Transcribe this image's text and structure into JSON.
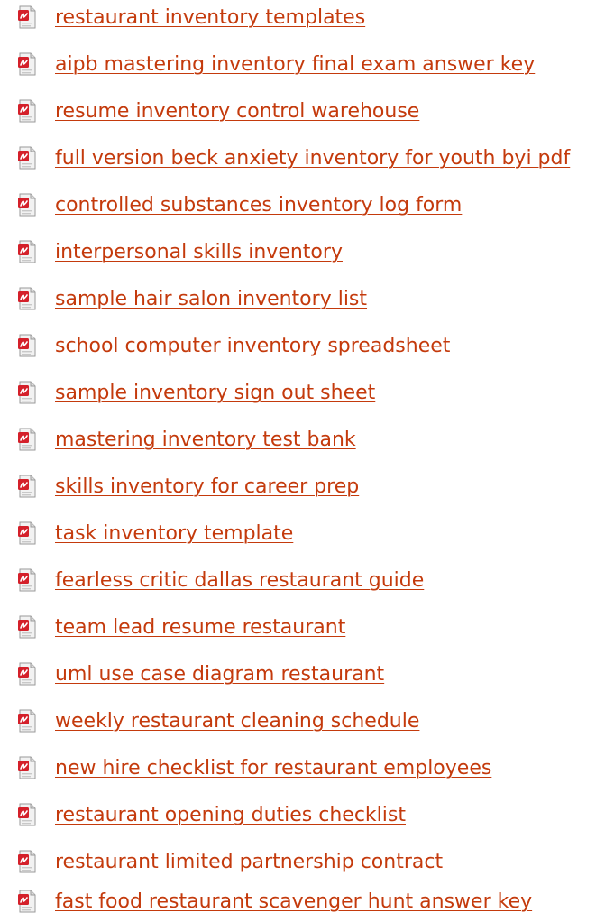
{
  "colors": {
    "link": "#c43a0c",
    "icon_red": "#d4202a",
    "icon_page": "#f2f2f2"
  },
  "icon": "pdf-file-icon",
  "links": [
    "restaurant inventory templates",
    "aipb mastering inventory final exam answer key",
    "resume inventory control warehouse",
    "full version beck anxiety inventory for youth byi pdf",
    "controlled substances inventory log form",
    "interpersonal skills inventory",
    "sample hair salon inventory list",
    "school computer inventory spreadsheet",
    "sample inventory sign out sheet",
    "mastering inventory test bank",
    "skills inventory for career prep",
    "task inventory template",
    "fearless critic dallas restaurant guide",
    "team lead resume restaurant",
    "uml use case diagram restaurant",
    "weekly restaurant cleaning schedule",
    "new hire checklist for restaurant employees",
    "restaurant opening duties checklist",
    "restaurant limited partnership contract",
    "fast food restaurant scavenger hunt answer key"
  ]
}
